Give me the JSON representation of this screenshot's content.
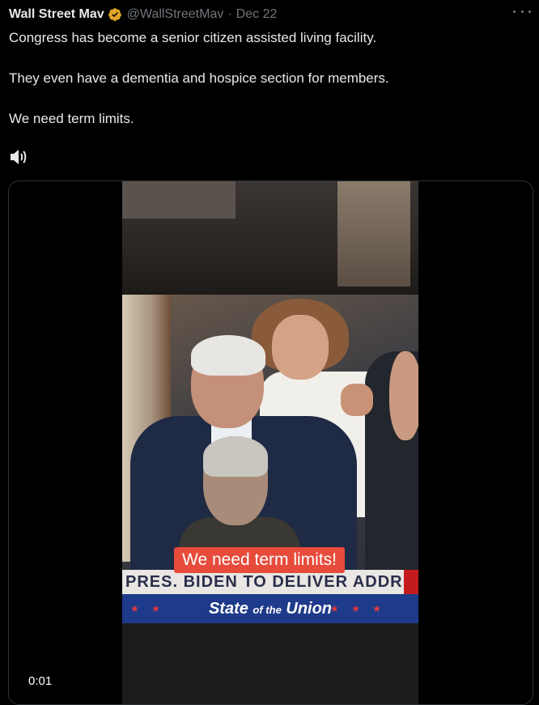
{
  "tweet": {
    "author_name": "Wall Street Mav",
    "handle": "@WallStreetMav",
    "separator": "·",
    "date": "Dec 22",
    "paragraphs": [
      "Congress has become a senior citizen assisted living facility.",
      "They even have a dementia and hospice section for members.",
      "We need term limits."
    ]
  },
  "video": {
    "caption": "We need term limits!",
    "ticker_text": "PRES. BIDEN TO DELIVER ADDRESS",
    "banner_main": "State",
    "banner_of_the": "of the",
    "banner_union": "Union",
    "stars_left": "★ ★",
    "stars_right": "★ ★ ★",
    "timestamp": "0:01"
  },
  "colors": {
    "background": "#000000",
    "text": "#e7e9ea",
    "secondary": "#71767b",
    "verified_badge": "#e0a526",
    "caption_bg": "#e74b3b"
  },
  "icons": [
    "verified-badge-icon",
    "more-options-icon",
    "speaker-icon"
  ]
}
